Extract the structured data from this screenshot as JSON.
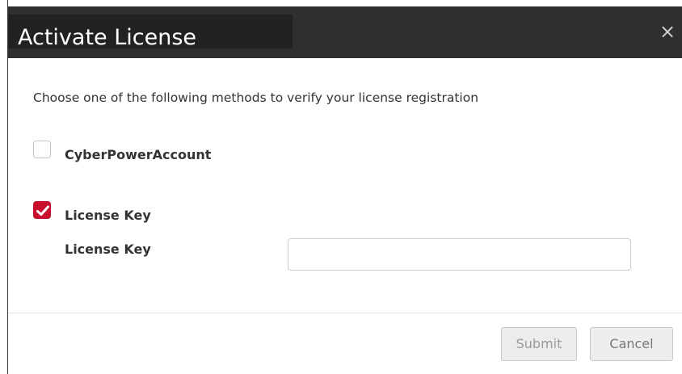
{
  "dialog": {
    "title": "Activate License",
    "close_symbol": "×",
    "instruction": "Choose one of the following methods to verify your license registration",
    "options": [
      {
        "label": "CyberPowerAccount",
        "checked": false
      },
      {
        "label": "License Key",
        "checked": true
      }
    ],
    "license_key_field": {
      "label": "License Key",
      "value": "",
      "placeholder": ""
    },
    "buttons": {
      "submit": "Submit",
      "cancel": "Cancel"
    }
  },
  "colors": {
    "titlebar": "#2f2f2f",
    "checkbox_checked": "#c8102e"
  }
}
